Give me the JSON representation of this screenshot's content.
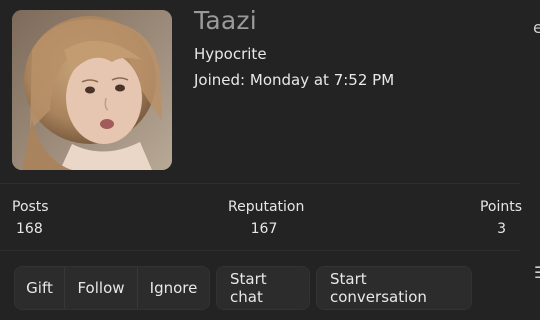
{
  "profile": {
    "username": "Taazi",
    "title": "Hypocrite",
    "joined_label": "Joined:",
    "joined_value": "Monday at 7:52 PM"
  },
  "stats": {
    "posts_label": "Posts",
    "posts_value": "168",
    "reputation_label": "Reputation",
    "reputation_value": "167",
    "points_label": "Points",
    "points_value": "3"
  },
  "actions": {
    "gift_label": "Gift",
    "follow_label": "Follow",
    "ignore_label": "Ignore",
    "start_chat_label": "Start chat",
    "start_conversation_label": "Start conversation"
  },
  "edge": {
    "top_glyph": "e",
    "menu_glyph": "☰"
  },
  "icons": {
    "menu": "menu-icon"
  },
  "colors": {
    "background": "#232323",
    "button_bg": "#2c2c2c",
    "username": "#9a9a9a",
    "text": "#e8e8e8"
  }
}
